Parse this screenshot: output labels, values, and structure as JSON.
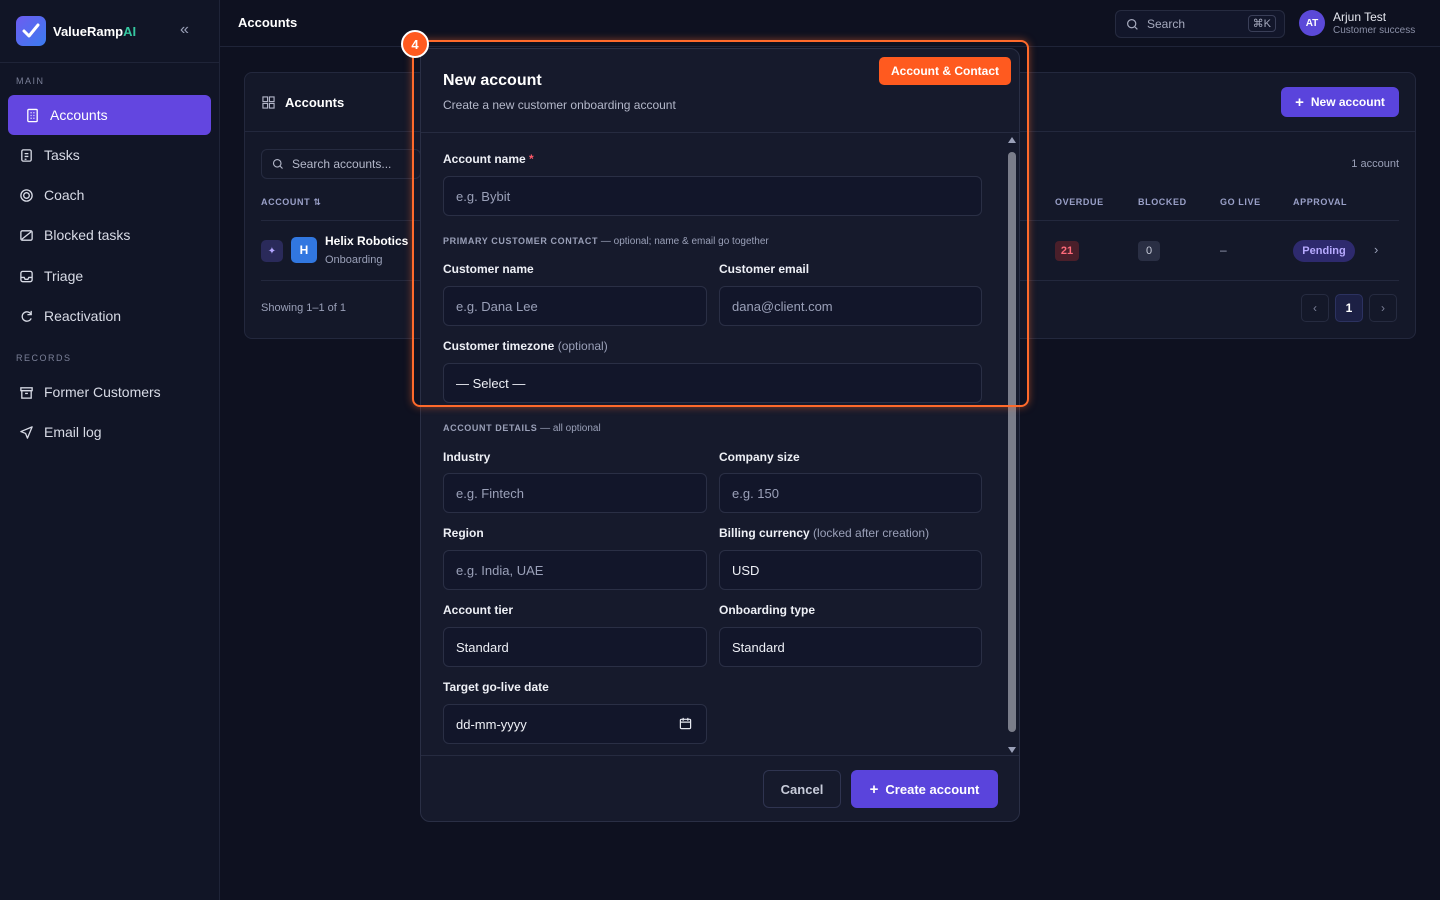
{
  "brand": {
    "name": "ValueRamp",
    "suffix": "AI"
  },
  "sidebar": {
    "main_label": "MAIN",
    "records_label": "RECORDS",
    "items": [
      {
        "label": "Accounts",
        "icon": "building-icon",
        "active": true
      },
      {
        "label": "Tasks",
        "icon": "clipboard-icon"
      },
      {
        "label": "Coach",
        "icon": "target-icon"
      },
      {
        "label": "Blocked tasks",
        "icon": "blocked-icon"
      },
      {
        "label": "Triage",
        "icon": "inbox-icon"
      },
      {
        "label": "Reactivation",
        "icon": "refresh-icon"
      }
    ],
    "records": [
      {
        "label": "Former Customers",
        "icon": "archive-icon"
      },
      {
        "label": "Email log",
        "icon": "send-icon"
      }
    ]
  },
  "topbar": {
    "title": "Accounts",
    "search_label": "Search",
    "shortcut": "⌘K",
    "user": {
      "initials": "AT",
      "name": "Arjun Test",
      "role": "Customer success"
    }
  },
  "accounts_card": {
    "title": "Accounts",
    "new_button": "New account",
    "search_placeholder": "Search accounts...",
    "count": "1 account",
    "columns": {
      "account": "ACCOUNT",
      "overdue": "OVERDUE",
      "blocked": "BLOCKED",
      "golive": "GO LIVE",
      "approval": "APPROVAL"
    },
    "row": {
      "initial": "H",
      "name": "Helix Robotics",
      "stage": "Onboarding",
      "overdue": "21",
      "blocked": "0",
      "golive": "–",
      "approval": "Pending"
    },
    "showing": "Showing 1–1 of 1",
    "page": "1"
  },
  "modal": {
    "title": "New account",
    "subtitle": "Create a new customer onboarding account",
    "account_name_label": "Account name",
    "account_name_placeholder": "e.g. Bybit",
    "primary_section": "PRIMARY CUSTOMER CONTACT",
    "primary_note": " — optional; name & email go together",
    "customer_name_label": "Customer name",
    "customer_name_placeholder": "e.g. Dana Lee",
    "customer_email_label": "Customer email",
    "customer_email_placeholder": "dana@client.com",
    "timezone_label": "Customer timezone",
    "timezone_opt": " (optional)",
    "timezone_value": "— Select —",
    "details_section": "ACCOUNT DETAILS",
    "details_note": " — all optional",
    "industry_label": "Industry",
    "industry_placeholder": "e.g. Fintech",
    "company_size_label": "Company size",
    "company_size_placeholder": "e.g. 150",
    "region_label": "Region",
    "region_placeholder": "e.g. India, UAE",
    "currency_label": "Billing currency",
    "currency_note": " (locked after creation)",
    "currency_value": "USD",
    "tier_label": "Account tier",
    "tier_value": "Standard",
    "onboarding_label": "Onboarding type",
    "onboarding_value": "Standard",
    "golive_label": "Target go-live date",
    "golive_placeholder": "dd-mm-yyyy",
    "cancel": "Cancel",
    "create": "Create account"
  },
  "annotation": {
    "number": "4",
    "tag": "Account & Contact"
  },
  "colors": {
    "accent": "#5a44dc",
    "highlight": "#ff5a1f",
    "bg": "#0e1120"
  }
}
